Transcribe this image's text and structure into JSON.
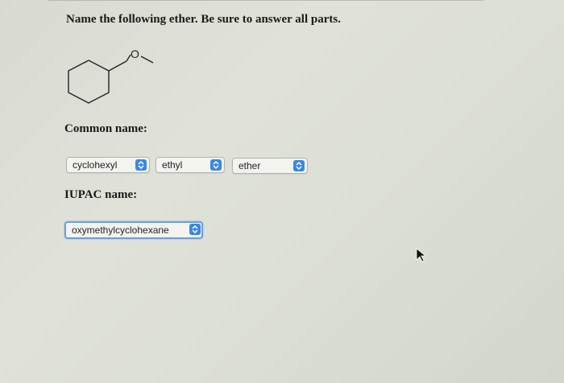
{
  "question": "Name the following ether. Be sure to answer all parts.",
  "molecule_atom_label": "O",
  "common_name": {
    "label": "Common name:",
    "dropdowns": [
      {
        "selected": "cyclohexyl",
        "icon": "up-down-arrows-icon"
      },
      {
        "selected": "ethyl",
        "icon": "up-down-arrows-icon"
      },
      {
        "selected": "ether",
        "icon": "up-down-arrows-icon"
      }
    ]
  },
  "iupac_name": {
    "label": "IUPAC name:",
    "dropdown": {
      "selected": "oxymethylcyclohexane",
      "icon": "up-down-arrows-icon"
    }
  },
  "colors": {
    "accent": "#3a86e6",
    "focus": "#6f9fd6"
  }
}
